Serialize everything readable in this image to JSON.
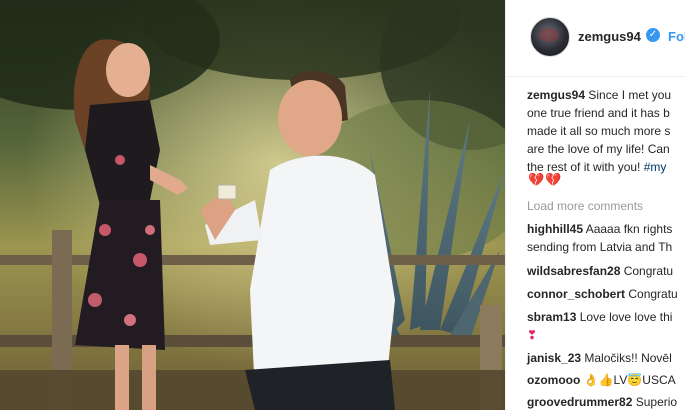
{
  "post": {
    "username": "zemgus94",
    "follow_label": "Fol",
    "verified_icon": "verified-badge-icon",
    "caption": {
      "author": "zemgus94",
      "lines": [
        "Since I met you",
        "one true friend and it has b",
        "made it all so much more s",
        "are the love of my life! Can",
        "the rest of it with you! #my"
      ],
      "hashtag": "#my",
      "emoji": "💔💔"
    },
    "load_more": "Load more comments",
    "comments": [
      {
        "user": "highhill45",
        "text": "Aaaaa fkn rights",
        "cont": "sending from Latvia and Th"
      },
      {
        "user": "wildsabresfan28",
        "text": "Congratu"
      },
      {
        "user": "connor_schobert",
        "text": "Congratu"
      },
      {
        "user": "sbram13",
        "text": "Love love love thi",
        "cont": "❣"
      },
      {
        "user": "janisk_23",
        "text": "Maločiks!! Novēl"
      },
      {
        "user": "ozomooo",
        "text": "👌👍LV😇USCA"
      },
      {
        "user": "groovedrummer82",
        "text": "Superio"
      }
    ]
  },
  "colors": {
    "link": "#3897f0",
    "text": "#262626",
    "muted": "#999999"
  }
}
